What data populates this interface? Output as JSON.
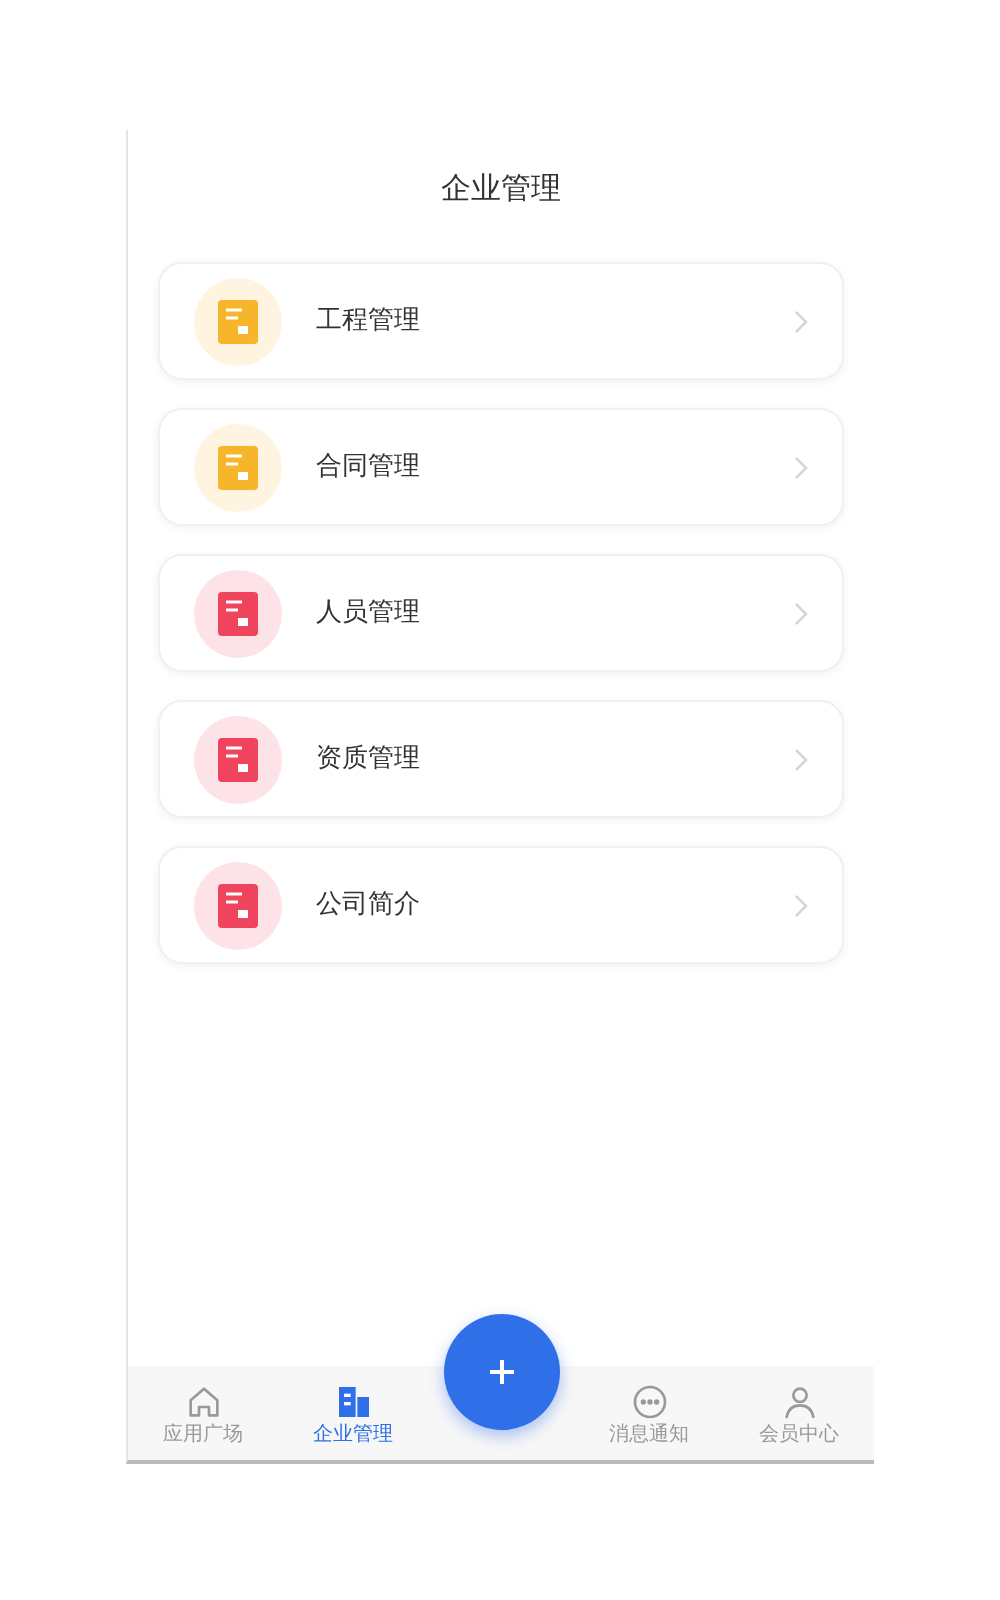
{
  "header": {
    "title": "企业管理"
  },
  "menu": [
    {
      "label": "工程管理",
      "color": "#f7b52c"
    },
    {
      "label": "合同管理",
      "color": "#f7b52c"
    },
    {
      "label": "人员管理",
      "color": "#f0445e"
    },
    {
      "label": "资质管理",
      "color": "#f0445e"
    },
    {
      "label": "公司简介",
      "color": "#f0445e"
    }
  ],
  "tabs": [
    {
      "label": "应用广场",
      "kind": "home",
      "selected": false
    },
    {
      "label": "企业管理",
      "kind": "building",
      "selected": true
    },
    {
      "label": "消息通知",
      "kind": "chat",
      "selected": false
    },
    {
      "label": "会员中心",
      "kind": "user",
      "selected": false
    }
  ]
}
